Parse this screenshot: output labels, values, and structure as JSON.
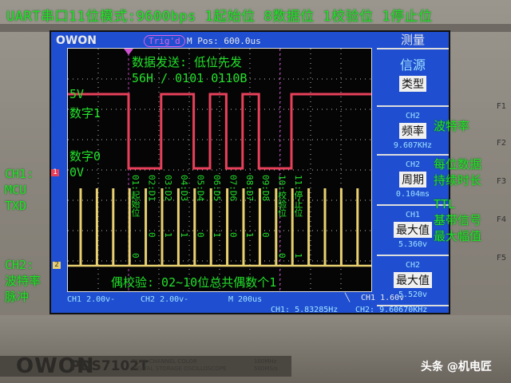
{
  "annotations": {
    "top_line": "UART串口11位模式:9600bps 1起始位 8数据位 1校验位 1停止位",
    "data_send": "数据发送: 低位先发",
    "data_value": "56H / 0101 0110B",
    "level_5v": "5V",
    "digit_1": "数字1",
    "digit_0": "数字0",
    "level_0v": "0V",
    "ch1_desc": [
      "CH1:",
      "MCU",
      "TXD"
    ],
    "ch2_desc": [
      "CH2:",
      "波特率",
      "脉冲"
    ],
    "parity_note": "偶校验: 02~10位总共偶数个1",
    "baud_note": "波特率",
    "period_note": [
      "每位数据",
      "持续时长"
    ],
    "max_note": [
      "TTL",
      "基带信号",
      "最大幅值"
    ]
  },
  "bits": [
    {
      "label": "01:起始位",
      "value": "0"
    },
    {
      "label": "02:D1",
      "value": "0"
    },
    {
      "label": "03:D2",
      "value": "1"
    },
    {
      "label": "04:D3",
      "value": "1"
    },
    {
      "label": "05:D4",
      "value": "0"
    },
    {
      "label": "06:D5",
      "value": "1"
    },
    {
      "label": "07:D6",
      "value": "0"
    },
    {
      "label": "08:D7",
      "value": "1"
    },
    {
      "label": "09:D8",
      "value": "0"
    },
    {
      "label": "10:校验位",
      "value": "0"
    },
    {
      "label": "11:停止位",
      "value": "1"
    }
  ],
  "scope": {
    "brand": "OWON",
    "trig_status": "Trig'd",
    "m_pos": "M Pos: 600.0us",
    "ch1_marker": "1",
    "ch2_marker": "2",
    "ch1_scale": "CH1 2.00v-",
    "ch2_scale": "CH2 2.00v-",
    "timebase": "M 200us",
    "trigger_level": "CH1 1.60v",
    "ch1_freq": "CH1: 5.83285Hz",
    "ch2_freq": "CH2: 9.60670KHz",
    "menu": {
      "title": "测量",
      "source": "信源",
      "type_btn": "类型",
      "items": [
        {
          "channel": "CH2",
          "button": "频率",
          "value": "9.607KHz"
        },
        {
          "channel": "CH2",
          "button": "周期",
          "value": "0.104ms"
        },
        {
          "channel": "CH1",
          "button": "最大值",
          "value": "5.360v"
        },
        {
          "channel": "CH2",
          "button": "最大值",
          "value": "5.520v"
        }
      ]
    },
    "fkeys": [
      "F1",
      "F2",
      "F3",
      "F4",
      "F5"
    ],
    "model": "PDS7102T",
    "description": [
      "DUAL CHANNEL COLOR",
      "DIGITAL STORAGE OSCILLOSCOPE"
    ],
    "spec": [
      "100MHz",
      "500MS/s"
    ]
  },
  "watermark": "头条 @机电匠",
  "colors": {
    "ch1": "#e8405a",
    "ch2": "#e8d070",
    "annotation": "#22e02a",
    "screen": "#1f4fd0"
  }
}
